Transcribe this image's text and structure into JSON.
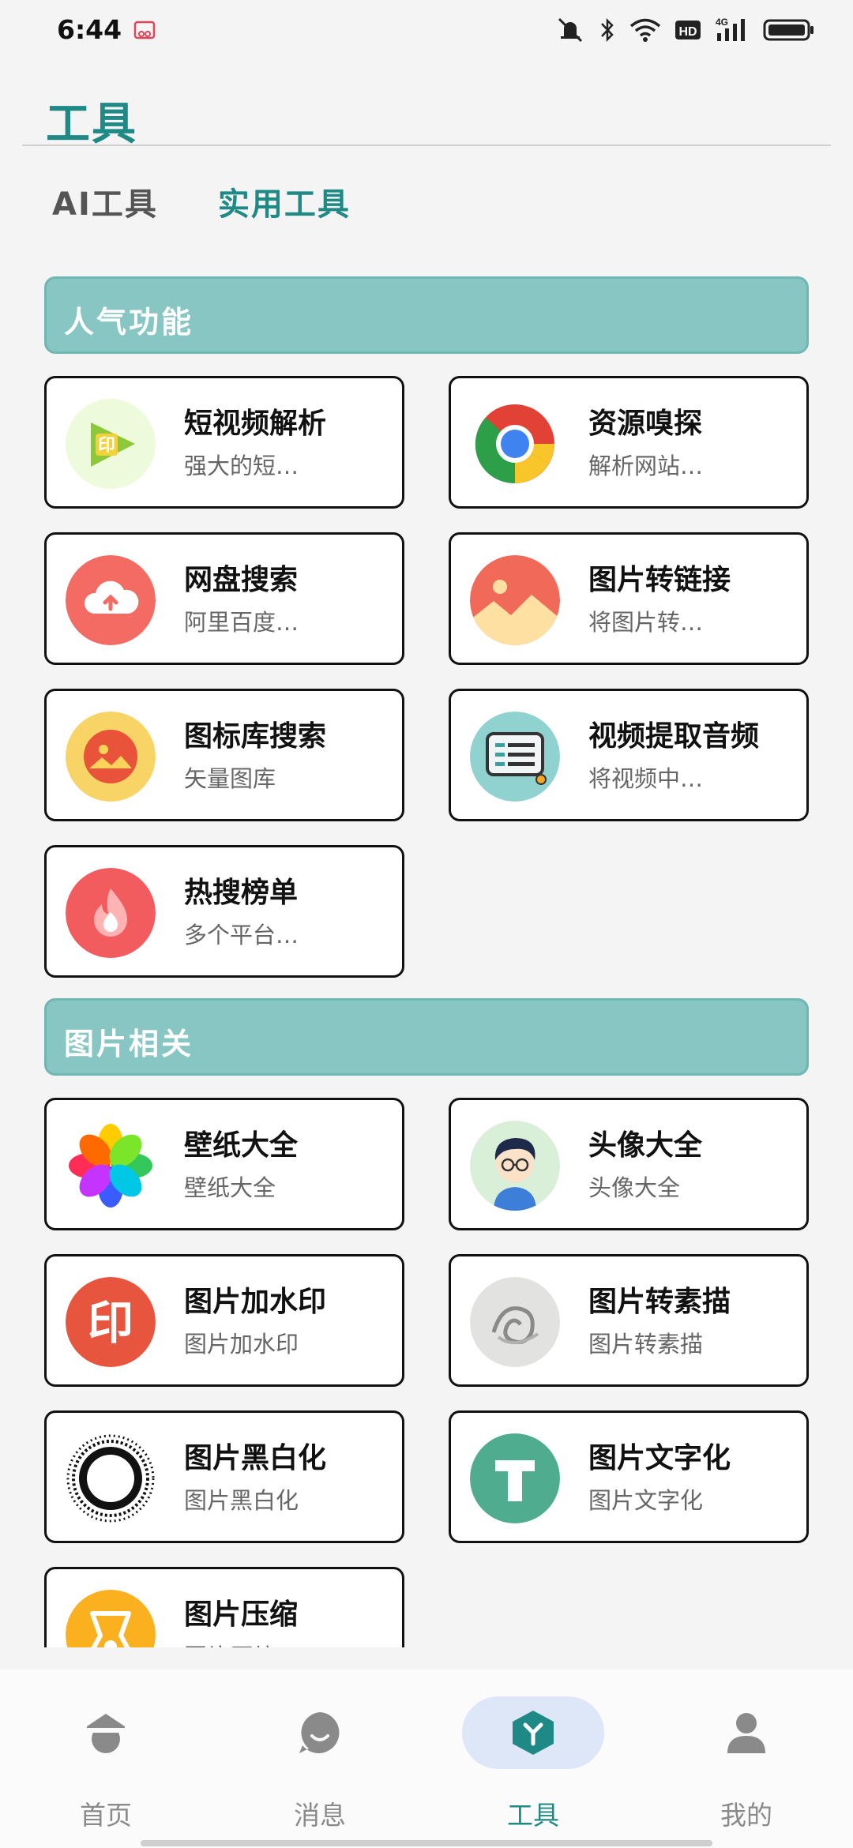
{
  "status": {
    "time": "6:44"
  },
  "header": {
    "title": "工具"
  },
  "tabs": [
    {
      "label": "AI工具",
      "active": false
    },
    {
      "label": "实用工具",
      "active": true
    }
  ],
  "sections": [
    {
      "title": "人气功能",
      "cards": [
        {
          "title": "短视频解析",
          "desc": "强大的短…",
          "icon": "video-parse-icon"
        },
        {
          "title": "资源嗅探",
          "desc": "解析网站…",
          "icon": "chrome-icon"
        },
        {
          "title": "网盘搜索",
          "desc": "阿里百度…",
          "icon": "cloud-upload-icon"
        },
        {
          "title": "图片转链接",
          "desc": "将图片转…",
          "icon": "image-landscape-icon"
        },
        {
          "title": "图标库搜索",
          "desc": "矢量图库",
          "icon": "icon-library-icon"
        },
        {
          "title": "视频提取音频",
          "desc": "将视频中…",
          "icon": "audio-extract-icon"
        },
        {
          "title": "热搜榜单",
          "desc": "多个平台…",
          "icon": "flame-icon"
        }
      ]
    },
    {
      "title": "图片相关",
      "cards": [
        {
          "title": "壁纸大全",
          "desc": "壁纸大全",
          "icon": "colorful-flower-icon"
        },
        {
          "title": "头像大全",
          "desc": "头像大全",
          "icon": "avatar-cartoon-icon"
        },
        {
          "title": "图片加水印",
          "desc": "图片加水印",
          "icon": "watermark-icon"
        },
        {
          "title": "图片转素描",
          "desc": "图片转素描",
          "icon": "sketch-icon"
        },
        {
          "title": "图片黑白化",
          "desc": "图片黑白化",
          "icon": "black-white-icon"
        },
        {
          "title": "图片文字化",
          "desc": "图片文字化",
          "icon": "text-t-icon"
        },
        {
          "title": "图片压缩",
          "desc": "图片压缩",
          "icon": "compress-icon"
        }
      ]
    }
  ],
  "nav": [
    {
      "label": "首页",
      "icon": "home-icon",
      "active": false
    },
    {
      "label": "消息",
      "icon": "message-icon",
      "active": false
    },
    {
      "label": "工具",
      "icon": "tools-icon",
      "active": true
    },
    {
      "label": "我的",
      "icon": "profile-icon",
      "active": false
    }
  ],
  "colors": {
    "accent": "#1f8a85",
    "section": "#87c6c2",
    "nav_active_bg": "#dde7f8"
  }
}
